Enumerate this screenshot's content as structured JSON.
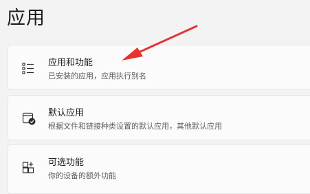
{
  "page": {
    "title": "应用"
  },
  "items": [
    {
      "title": "应用和功能",
      "subtitle": "已安装的应用，应用执行别名",
      "icon": "apps-list-icon"
    },
    {
      "title": "默认应用",
      "subtitle": "根据文件和链接种类设置的默认应用，其他默认应用",
      "icon": "default-apps-icon"
    },
    {
      "title": "可选功能",
      "subtitle": "你的设备的额外功能",
      "icon": "optional-features-icon"
    }
  ],
  "annotation": {
    "arrow_color": "#e8322f"
  }
}
